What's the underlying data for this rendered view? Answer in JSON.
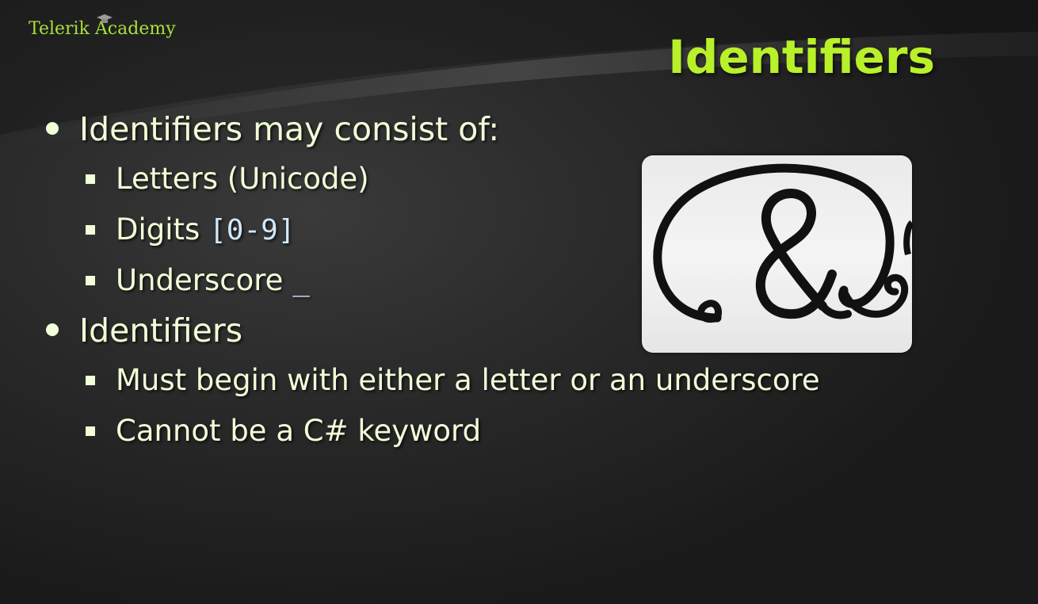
{
  "header": {
    "logo_text": "Telerik Academy",
    "title": "Identifiers"
  },
  "bullets": [
    {
      "text": "Identifiers may consist of:",
      "sub": [
        {
          "text": "Letters (Unicode)",
          "code": ""
        },
        {
          "text": "Digits ",
          "code": "[0-9]"
        },
        {
          "text": "Underscore ",
          "code": "_"
        }
      ]
    },
    {
      "text": "Identifiers",
      "sub": [
        {
          "text": "Must begin with either a letter or an underscore",
          "code": ""
        },
        {
          "text": "Cannot be a C# keyword",
          "code": ""
        }
      ]
    }
  ],
  "image": {
    "subject": "ampersand-at-sign-picture"
  },
  "colors": {
    "title": "#b8f02a",
    "logo": "#a7e03a",
    "text": "#f0ffd8",
    "code": "#d0e8ff",
    "background": "#2a2a2a"
  }
}
